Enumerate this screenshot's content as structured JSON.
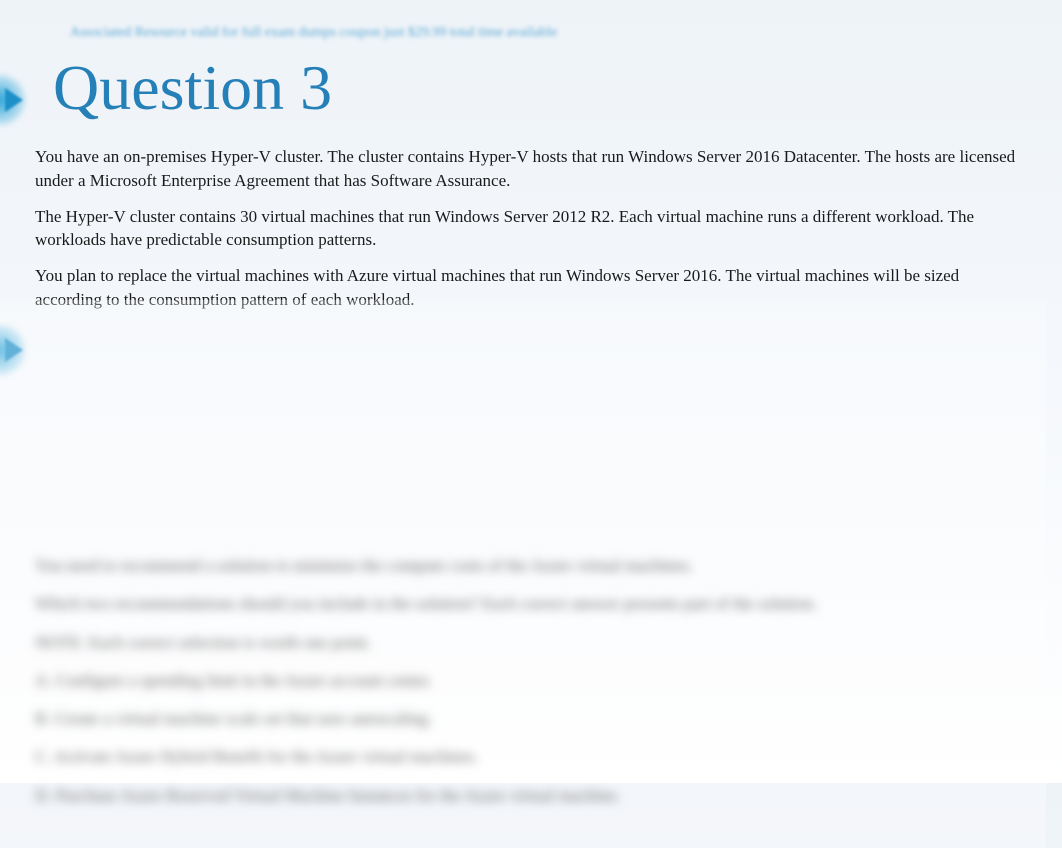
{
  "breadcrumb": {
    "text": "Associated Resource valid for full exam dumps coupon just $29.99 total time available"
  },
  "title": "Question 3",
  "paragraphs": {
    "p1": "You have an on-premises Hyper-V cluster. The cluster contains Hyper-V hosts that run Windows Server 2016 Datacenter. The hosts are licensed under a Microsoft Enterprise Agreement that has Software Assurance.",
    "p2": "The Hyper-V cluster contains 30 virtual machines that run Windows Server 2012 R2. Each virtual machine runs a different workload. The workloads have predictable consumption patterns.",
    "p3": "You plan to replace the virtual machines with Azure virtual machines that run Windows Server 2016. The virtual machines will be sized according to the consumption pattern of each workload."
  },
  "blurred": {
    "line1": "You need to recommend a solution to minimize the compute costs of the Azure virtual machines.",
    "line2": "Which two recommendations should you include in the solution? Each correct answer presents part of the solution.",
    "line3": "NOTE: Each correct selection is worth one point.",
    "line4": "A. Configure a spending limit in the Azure account center.",
    "line5": "B. Create a virtual machine scale set that uses autoscaling.",
    "line6": "C. Activate Azure Hybrid Benefit for the Azure virtual machines.",
    "line7": "D. Purchase Azure Reserved Virtual Machine Instances for the Azure virtual machine."
  }
}
